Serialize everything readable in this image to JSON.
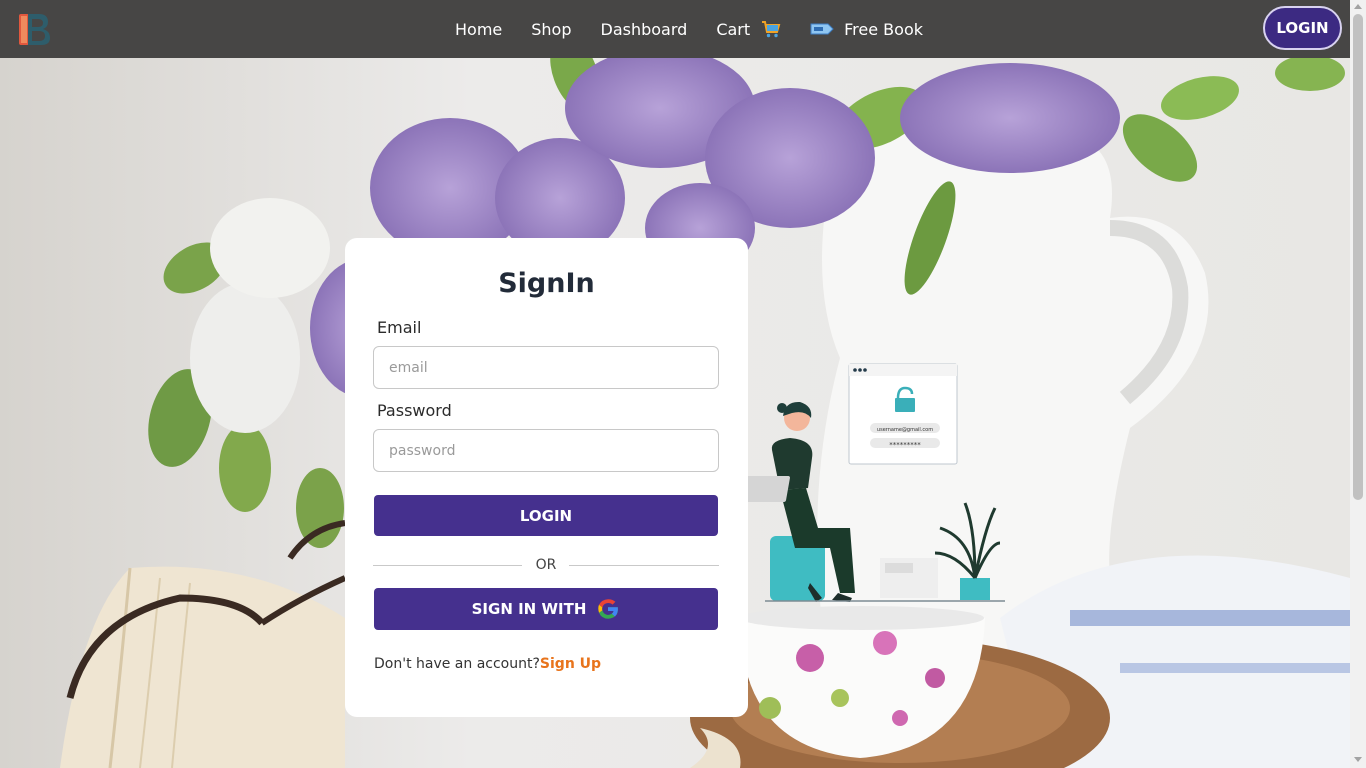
{
  "nav": {
    "logo_icon": "book-logo-icon",
    "links": [
      {
        "label": "Home"
      },
      {
        "label": "Shop"
      },
      {
        "label": "Dashboard"
      },
      {
        "label": "Cart",
        "icon": "cart-icon"
      },
      {
        "label": "Free Book",
        "icon": "free-tag-icon"
      }
    ],
    "login_label": "LOGIN"
  },
  "signin": {
    "title": "SignIn",
    "email_label": "Email",
    "email_placeholder": "email",
    "password_label": "Password",
    "password_placeholder": "password",
    "login_button": "LOGIN",
    "divider_text": "OR",
    "google_button": "SIGN IN WITH",
    "google_icon": "google-icon",
    "no_account_text": "Don't have an account?",
    "signup_link": "Sign Up"
  },
  "illustration": {
    "email_text": "username@gmail.com",
    "password_text": "*********"
  },
  "colors": {
    "navbar": "#474645",
    "accent": "#45308e",
    "link": "#e8741c"
  }
}
